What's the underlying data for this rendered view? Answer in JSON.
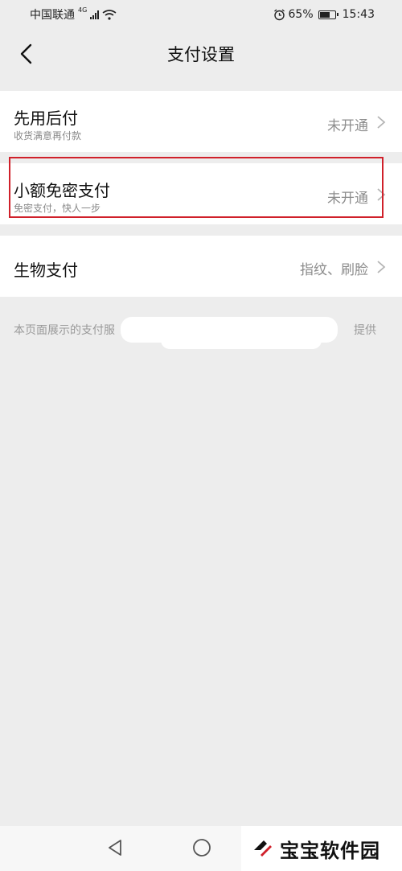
{
  "status_bar": {
    "carrier": "中国联通",
    "network": "4G",
    "battery": "65%",
    "time": "15:43"
  },
  "header": {
    "title": "支付设置"
  },
  "items": [
    {
      "title": "先用后付",
      "subtitle": "收货满意再付款",
      "status": "未开通"
    },
    {
      "title": "小额免密支付",
      "subtitle": "免密支付，快人一步",
      "status": "未开通"
    },
    {
      "title": "生物支付",
      "status": "指纹、刷脸"
    }
  ],
  "footer": {
    "note_start": "本页面展示的支付服",
    "note_end": "提供"
  },
  "watermark": {
    "text": "宝宝软件园"
  },
  "colors": {
    "background": "#ededed",
    "card": "#ffffff",
    "highlight": "#d0202a",
    "secondary_text": "#8c8c8c"
  }
}
